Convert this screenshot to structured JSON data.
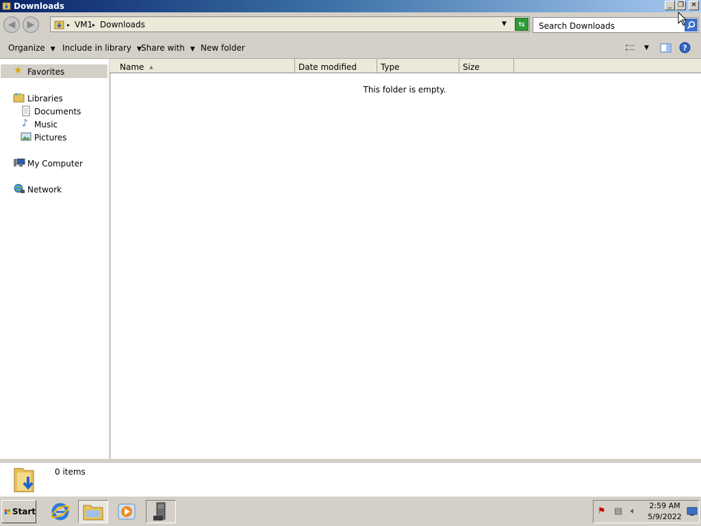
{
  "window": {
    "title": "Downloads",
    "buttons": {
      "minimize": "_",
      "restore": "❐",
      "close": "✕"
    }
  },
  "address": {
    "segments": [
      "VM1",
      "Downloads"
    ],
    "separator": "▸",
    "search_placeholder": "Search Downloads"
  },
  "commands": {
    "organize": "Organize",
    "include_in_library": "Include in library",
    "share_with": "Share with",
    "new_folder": "New folder"
  },
  "nav": {
    "favorites": "Favorites",
    "libraries": "Libraries",
    "documents": "Documents",
    "music": "Music",
    "pictures": "Pictures",
    "my_computer": "My Computer",
    "network": "Network"
  },
  "columns": [
    "Name",
    "Date modified",
    "Type",
    "Size"
  ],
  "content": {
    "empty_message": "This folder is empty."
  },
  "details": {
    "item_count": "0 items"
  },
  "taskbar": {
    "start_label": "Start",
    "time": "2:59 AM",
    "date": "5/9/2022"
  },
  "icons": {
    "app": "downloads-folder-icon",
    "back": "back-arrow-icon",
    "forward": "forward-arrow-icon",
    "refresh": "refresh-icon",
    "search": "search-icon",
    "views": "change-view-icon",
    "preview_pane": "preview-pane-icon",
    "help": "help-icon"
  },
  "colors": {
    "titlebar_start": "#0a246a",
    "titlebar_end": "#a6caf0",
    "chrome": "#d4d0c8",
    "accent_blue": "#3b6fc7"
  }
}
